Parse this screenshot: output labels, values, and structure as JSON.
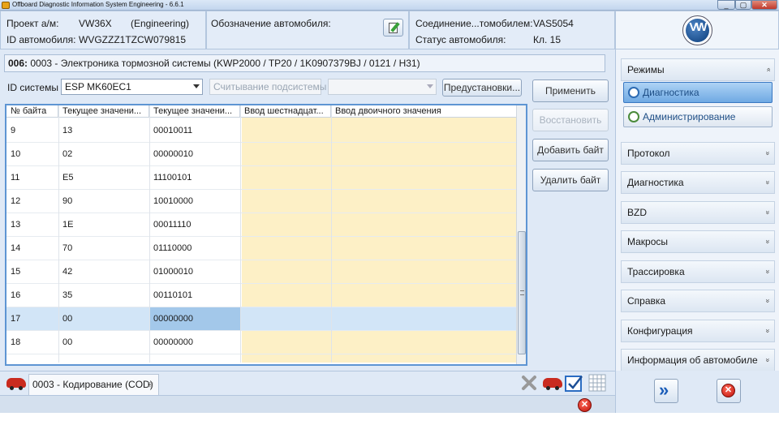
{
  "window": {
    "title": "Offboard Diagnostic Information System Engineering - 6.6.1",
    "min": "_",
    "max": "▢",
    "close": "✕"
  },
  "header": {
    "project_label": "Проект а/м:",
    "project_value": "VW36X",
    "project_mode": "(Engineering)",
    "id_label": "ID автомобиля:",
    "id_value": "WVGZZZ1TZCW079815",
    "designation_label": "Обозначение автомобиля:",
    "connection_label": "Соединение...томобилем:",
    "connection_value": "VAS5054",
    "status_label": "Статус автомобиля:",
    "status_value": "Кл. 15",
    "logo": "VW"
  },
  "ecu": {
    "code": "006:",
    "description": "0003 - Электроника тормозной системы  (KWP2000 / TP20 / 1K0907379BJ / 0121 / H31)"
  },
  "controls": {
    "system_id_label": "ID системы",
    "system_id_value": "ESP MK60EC1",
    "subsystem_placeholder": "Считывание подсистемы",
    "subsystem_value": "",
    "presets_button": "Предустановки...",
    "apply_button": "Применить",
    "restore_button": "Восстановить",
    "add_byte_button": "Добавить байт",
    "delete_byte_button": "Удалить байт"
  },
  "table": {
    "columns": [
      "№ байта",
      "Текущее значени...",
      "Текущее значени...",
      "Ввод шестнадцат...",
      "Ввод двоичного значения"
    ],
    "rows": [
      [
        "9",
        "13",
        "00010011",
        "",
        ""
      ],
      [
        "10",
        "02",
        "00000010",
        "",
        ""
      ],
      [
        "11",
        "E5",
        "11100101",
        "",
        ""
      ],
      [
        "12",
        "90",
        "10010000",
        "",
        ""
      ],
      [
        "13",
        "1E",
        "00011110",
        "",
        ""
      ],
      [
        "14",
        "70",
        "01110000",
        "",
        ""
      ],
      [
        "15",
        "42",
        "01000010",
        "",
        ""
      ],
      [
        "16",
        "35",
        "00110101",
        "",
        ""
      ],
      [
        "17",
        "00",
        "00000000",
        "",
        ""
      ],
      [
        "18",
        "00",
        "00000000",
        "",
        ""
      ]
    ],
    "selected_row": "17"
  },
  "tabs": {
    "active_label": "0003 - Кодирование (COD)",
    "close": "⊠"
  },
  "sidebar": {
    "modes_header": "Режимы",
    "modes": [
      {
        "label": "Диагностика",
        "active": true
      },
      {
        "label": "Администрирование",
        "active": false
      }
    ],
    "sections": [
      "Протокол",
      "Диагностика",
      "BZD",
      "Макросы",
      "Трассировка",
      "Справка",
      "Конфигурация",
      "Информация об автомобиле"
    ],
    "chevron_up": "»",
    "chevron_down": "»",
    "forward": "»",
    "stop": "✕"
  },
  "colors": {
    "accent": "#5e95d3",
    "input_cells": "#fdf0c6",
    "selection": "#d2e5f7",
    "error": "#c0130a"
  }
}
